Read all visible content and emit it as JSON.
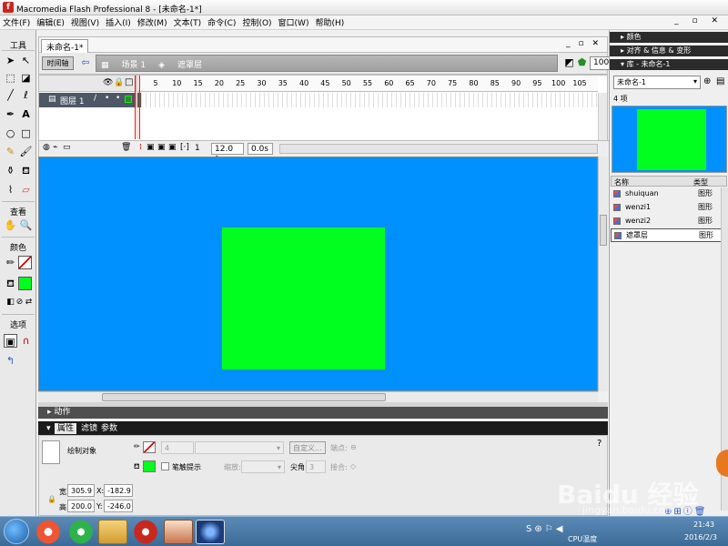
{
  "window": {
    "title": "Macromedia Flash Professional 8 - [未命名-1*]"
  },
  "menu": [
    "文件(F)",
    "编辑(E)",
    "视图(V)",
    "插入(I)",
    "修改(M)",
    "文本(T)",
    "命令(C)",
    "控制(O)",
    "窗口(W)",
    "帮助(H)"
  ],
  "tools": {
    "title": "工具",
    "view_title": "查看",
    "colors_title": "颜色",
    "options_title": "选项"
  },
  "document": {
    "tab": "未命名-1*",
    "timeline_button": "时间轴",
    "scene": "场景 1",
    "symbol": "遮罩层",
    "zoom": "100%"
  },
  "timeline": {
    "ruler": [
      "5",
      "10",
      "15",
      "20",
      "25",
      "30",
      "35",
      "40",
      "45",
      "50",
      "55",
      "60",
      "65",
      "70",
      "75",
      "80",
      "85",
      "90",
      "95",
      "100",
      "105"
    ],
    "layer_name": "图层 1",
    "current_frame": "1",
    "fps": "12.0 fps",
    "time": "0.0s"
  },
  "stage": {
    "background": "#0091ff",
    "shape_color": "#00ff1e"
  },
  "panels": {
    "actions": "动作",
    "properties": "属性",
    "filters": "滤镜",
    "parameters": "参数"
  },
  "properties": {
    "object_type": "绘制对象",
    "stroke_size": "4",
    "custom_button": "自定义...",
    "endpoint_label": "端点:",
    "stroke_hint": "笔触提示",
    "scale_label": "缩放:",
    "miter_label": "尖角:",
    "miter_value": "3",
    "join_label": "接合:",
    "width_label": "宽:",
    "width": "305.9",
    "height_label": "高:",
    "height": "200.0",
    "x_label": "X:",
    "x": "-182.9",
    "y_label": "Y:",
    "y": "-246.0"
  },
  "right_panels": {
    "color": "颜色",
    "align": "对齐 & 信息 & 变形",
    "library_title": "库 - 未命名-1",
    "library_select": "未命名-1",
    "item_count": "4 项",
    "col_name": "名称",
    "col_type": "类型",
    "items": [
      {
        "name": "shuiquan",
        "type": "图形"
      },
      {
        "name": "wenzi1",
        "type": "图形"
      },
      {
        "name": "wenzi2",
        "type": "图形"
      },
      {
        "name": "遮罩层",
        "type": "图形"
      }
    ]
  },
  "taskbar": {
    "time": "21:43",
    "date": "2016/2/3",
    "cpu_label": "CPU温度"
  },
  "watermark": {
    "logo": "Baidu 经验",
    "url": "jingyan.baidu.com"
  }
}
